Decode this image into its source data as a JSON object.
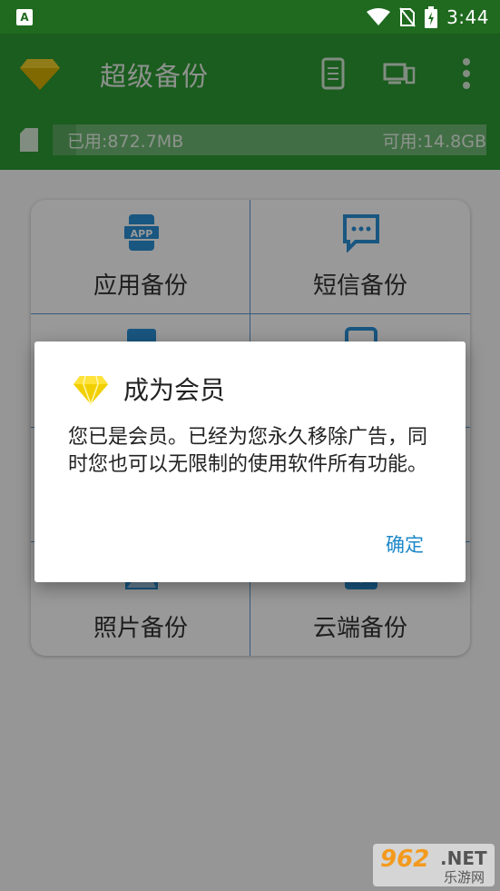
{
  "status_bar": {
    "time": "3:44"
  },
  "app_bar": {
    "title": "超级备份",
    "storage": {
      "used": "已用:872.7MB",
      "free": "可用:14.8GB",
      "used_fraction": 0.055
    }
  },
  "grid": {
    "items": [
      {
        "label": "应用备份",
        "icon": "app-icon"
      },
      {
        "label": "短信备份",
        "icon": "sms-icon"
      },
      {
        "label": "",
        "icon": "contacts-icon"
      },
      {
        "label": "",
        "icon": "call-log-icon"
      },
      {
        "label": "",
        "icon": "calendar-icon"
      },
      {
        "label": "",
        "icon": "settings-icon"
      },
      {
        "label": "照片备份",
        "icon": "photo-icon"
      },
      {
        "label": "云端备份",
        "icon": "cloud-icon"
      }
    ]
  },
  "dialog": {
    "title": "成为会员",
    "message": "您已是会员。已经为您永久移除广告，同时您也可以无限制的使用软件所有功能。",
    "confirm": "确定"
  },
  "watermark": {
    "number": "962",
    "domain": ".NET",
    "site": "乐游网"
  },
  "colors": {
    "appbar": "#2e9a34",
    "statusbar": "#1f6a1f",
    "accent": "#1e88c8",
    "divider": "#5a9ad0"
  }
}
